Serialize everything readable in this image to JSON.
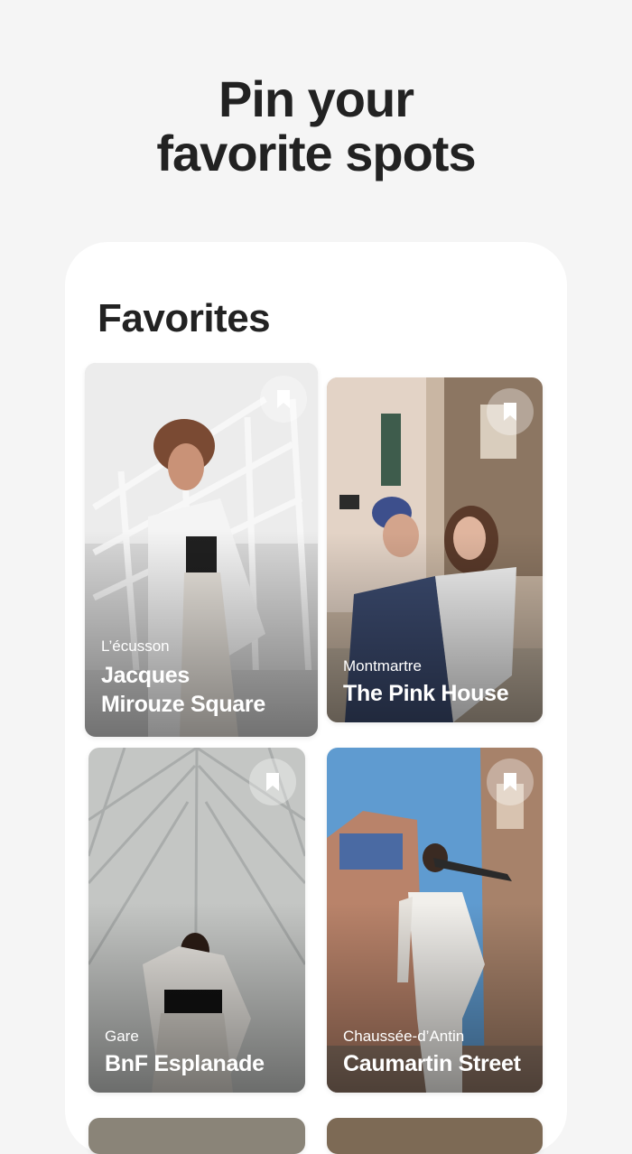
{
  "headline": {
    "line1": "Pin your",
    "line2": "favorite spots"
  },
  "favorites": {
    "title": "Favorites",
    "cards": [
      {
        "area": "L’écusson",
        "name_line1": "Jacques",
        "name_line2": "Mirouze Square",
        "icon": "bookmark-icon"
      },
      {
        "area": "Montmartre",
        "name_line1": "The Pink House",
        "icon": "bookmark-icon"
      },
      {
        "area": "Gare",
        "name_line1": "BnF Esplanade",
        "icon": "bookmark-icon"
      },
      {
        "area": "Chaussée-d’Antin",
        "name_line1": "Caumartin Street",
        "icon": "bookmark-icon"
      }
    ]
  },
  "colors": {
    "background": "#f5f5f5",
    "panel": "#ffffff",
    "text_dark": "#222222"
  }
}
